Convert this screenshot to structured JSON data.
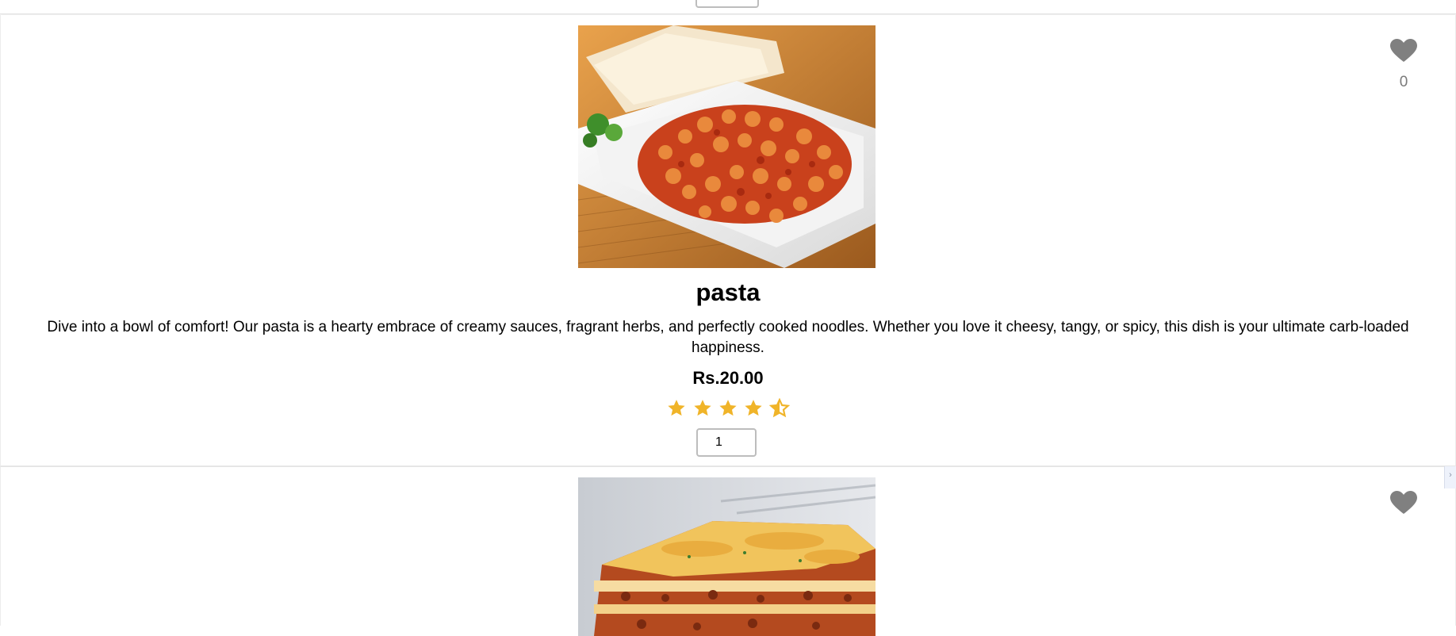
{
  "previous_card": {
    "quantity": ""
  },
  "cards": [
    {
      "name": "pasta",
      "description": "Dive into a bowl of comfort! Our pasta is a hearty embrace of creamy sauces, fragrant herbs, and perfectly cooked noodles. Whether you love it cheesy, tangy, or spicy, this dish is your ultimate carb-loaded happiness.",
      "price": "Rs.20.00",
      "rating": 4.5,
      "rating_max": 5,
      "quantity": "1",
      "likes": "0",
      "icons": {
        "like": "heart-icon",
        "rating": "star-icon",
        "image": "pasta-photo"
      },
      "colors": {
        "star": "#f0b429",
        "heart": "#808080"
      }
    },
    {
      "icons": {
        "like": "heart-icon",
        "image": "lasagna-photo"
      },
      "colors": {
        "heart": "#808080"
      }
    }
  ],
  "scroll_hint": {
    "icon": "chevron-right-icon"
  }
}
